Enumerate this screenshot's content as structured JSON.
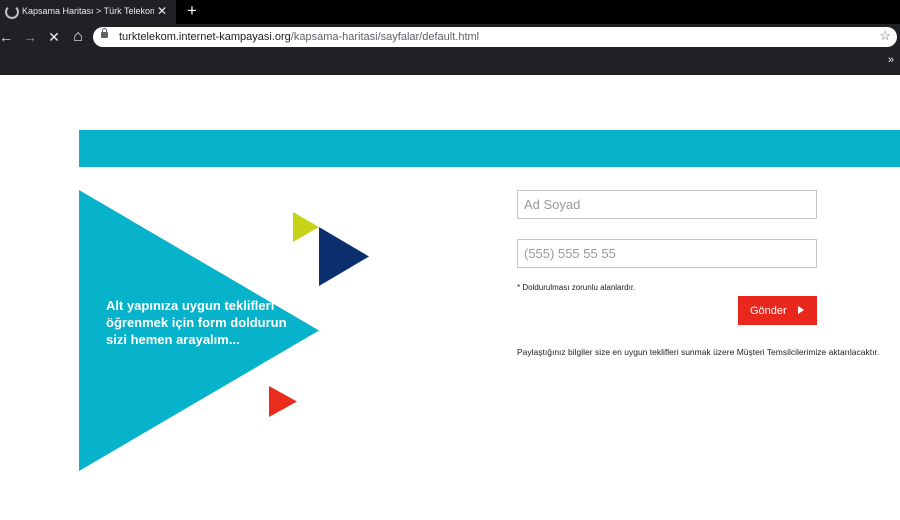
{
  "browser": {
    "tab_title": "Kapsama Haritası > Türk Telekom",
    "tab_close": "✕",
    "new_tab": "+",
    "nav": {
      "back": "←",
      "forward": "→",
      "stop": "✕",
      "home": "⌂"
    },
    "url_host": "turktelekom.internet-kampayasi.org",
    "url_path": "/kapsama-haritasi/sayfalar/default.html",
    "bookmark_more": "»",
    "icons": [
      "loading-spinner-icon",
      "close-icon",
      "plus-icon",
      "back-arrow-icon",
      "forward-arrow-icon",
      "stop-icon",
      "home-icon",
      "lock-icon",
      "star-icon"
    ]
  },
  "hero": {
    "text": "Alt yapınıza uygun tekliflerı öğrenmek için form doldurun sizi hemen arayalım..."
  },
  "form": {
    "name_placeholder": "Ad Soyad",
    "phone_placeholder": "(555) 555 55 55",
    "required_note": "* Doldurulması zorunlu alanlardır.",
    "submit_label": "Gönder",
    "disclaimer": "Paylaştığınız bilgiler size en uygun teklifleri sunmak üzere Müşteri Temsilcilerimize aktarılacaktır."
  },
  "colors": {
    "brand_cyan": "#06b3cb",
    "lime": "#c7d318",
    "navy": "#0a2e6e",
    "red": "#ea2c1c",
    "button_red": "#e8271d"
  }
}
